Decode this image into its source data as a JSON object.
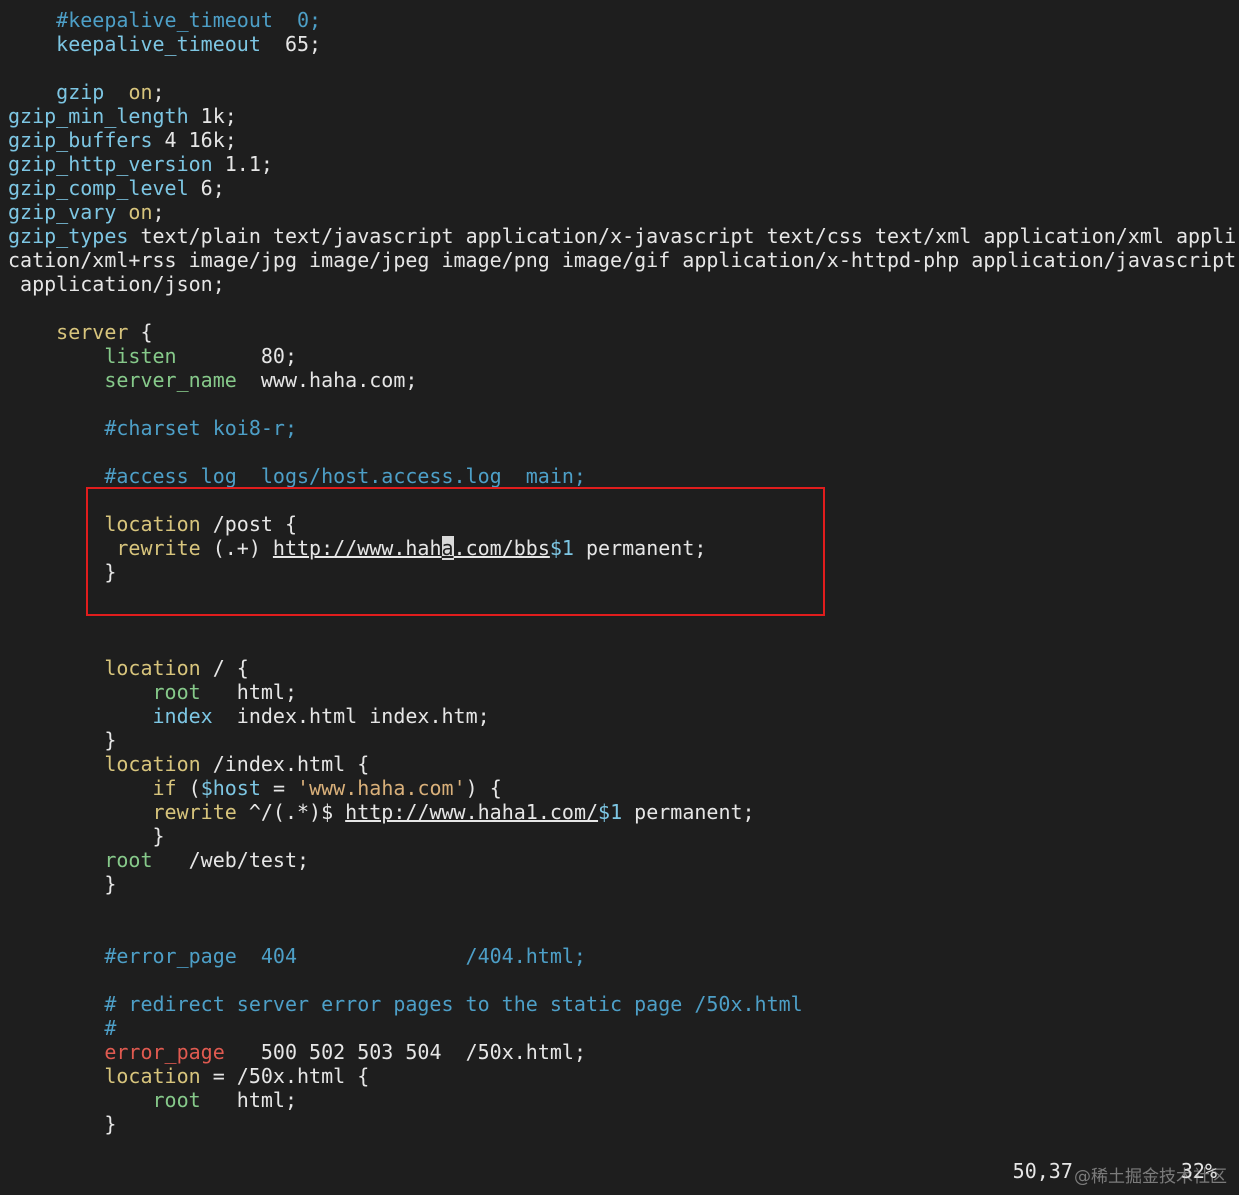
{
  "lines": [
    [
      {
        "t": "    "
      },
      {
        "t": "#keepalive_timeout  0;",
        "c": "cm"
      }
    ],
    [
      {
        "t": "    "
      },
      {
        "t": "keepalive_timeout",
        "c": "kw"
      },
      {
        "t": "  65;"
      }
    ],
    [
      {
        "t": ""
      }
    ],
    [
      {
        "t": "    "
      },
      {
        "t": "gzip",
        "c": "kw"
      },
      {
        "t": "  "
      },
      {
        "t": "on",
        "c": "kw2"
      },
      {
        "t": ";"
      }
    ],
    [
      {
        "t": "gzip_min_length",
        "c": "kw"
      },
      {
        "t": " 1k;"
      }
    ],
    [
      {
        "t": "gzip_buffers",
        "c": "kw"
      },
      {
        "t": " 4 16k;"
      }
    ],
    [
      {
        "t": "gzip_http_version",
        "c": "kw"
      },
      {
        "t": " 1.1;"
      }
    ],
    [
      {
        "t": "gzip_comp_level",
        "c": "kw"
      },
      {
        "t": " 6;"
      }
    ],
    [
      {
        "t": "gzip_vary",
        "c": "kw"
      },
      {
        "t": " "
      },
      {
        "t": "on",
        "c": "kw2"
      },
      {
        "t": ";"
      }
    ],
    [
      {
        "t": "gzip_types",
        "c": "kw"
      },
      {
        "t": " text/plain text/javascript application/x-javascript text/css text/xml application/xml appli"
      }
    ],
    [
      {
        "t": "cation/xml+rss image/jpg image/jpeg image/png image/gif application/x-httpd-php application/javascript"
      }
    ],
    [
      {
        "t": " application/json;"
      }
    ],
    [
      {
        "t": ""
      }
    ],
    [
      {
        "t": "    "
      },
      {
        "t": "server",
        "c": "kw2"
      },
      {
        "t": " {"
      }
    ],
    [
      {
        "t": "        "
      },
      {
        "t": "listen",
        "c": "kw3"
      },
      {
        "t": "       80;"
      }
    ],
    [
      {
        "t": "        "
      },
      {
        "t": "server_name",
        "c": "kw3"
      },
      {
        "t": "  www.haha.com;"
      }
    ],
    [
      {
        "t": ""
      }
    ],
    [
      {
        "t": "        "
      },
      {
        "t": "#charset koi8-r;",
        "c": "cm"
      }
    ],
    [
      {
        "t": ""
      }
    ],
    [
      {
        "t": "        "
      },
      {
        "t": "#access_log  logs/host.access.log  main;",
        "c": "cm"
      }
    ],
    [
      {
        "t": ""
      }
    ],
    [
      {
        "t": "        "
      },
      {
        "t": "location",
        "c": "kw2"
      },
      {
        "t": " /post {"
      }
    ],
    [
      {
        "t": "         "
      },
      {
        "t": "rewrite",
        "c": "kw2"
      },
      {
        "t": " (.+) "
      },
      {
        "t": "http://www.hah",
        "c": "url"
      },
      {
        "t": "a",
        "c": "cursor url"
      },
      {
        "t": ".com/bbs",
        "c": "url"
      },
      {
        "t": "$1",
        "c": "var"
      },
      {
        "t": " permanent;"
      }
    ],
    [
      {
        "t": "        }"
      }
    ],
    [
      {
        "t": ""
      }
    ],
    [
      {
        "t": ""
      }
    ],
    [
      {
        "t": ""
      }
    ],
    [
      {
        "t": "        "
      },
      {
        "t": "location",
        "c": "kw2"
      },
      {
        "t": " / {"
      }
    ],
    [
      {
        "t": "            "
      },
      {
        "t": "root",
        "c": "kw3"
      },
      {
        "t": "   html;"
      }
    ],
    [
      {
        "t": "            "
      },
      {
        "t": "index",
        "c": "kw"
      },
      {
        "t": "  index.html index.htm;"
      }
    ],
    [
      {
        "t": "        }"
      }
    ],
    [
      {
        "t": "        "
      },
      {
        "t": "location",
        "c": "kw2"
      },
      {
        "t": " /index.html {"
      }
    ],
    [
      {
        "t": "            "
      },
      {
        "t": "if",
        "c": "kw2"
      },
      {
        "t": " ("
      },
      {
        "t": "$host",
        "c": "var"
      },
      {
        "t": " = "
      },
      {
        "t": "'www.haha.com'",
        "c": "str"
      },
      {
        "t": ") {"
      }
    ],
    [
      {
        "t": "            "
      },
      {
        "t": "rewrite",
        "c": "kw2"
      },
      {
        "t": " ^/(.*)$ "
      },
      {
        "t": "http://www.haha1.com/",
        "c": "url"
      },
      {
        "t": "$1",
        "c": "var"
      },
      {
        "t": " permanent;"
      }
    ],
    [
      {
        "t": "            }"
      }
    ],
    [
      {
        "t": "        "
      },
      {
        "t": "root",
        "c": "kw3"
      },
      {
        "t": "   /web/test;"
      }
    ],
    [
      {
        "t": "        }"
      }
    ],
    [
      {
        "t": ""
      }
    ],
    [
      {
        "t": ""
      }
    ],
    [
      {
        "t": "        "
      },
      {
        "t": "#error_page  404              /404.html;",
        "c": "cm"
      }
    ],
    [
      {
        "t": ""
      }
    ],
    [
      {
        "t": "        "
      },
      {
        "t": "# redirect server error pages to the static page /50x.html",
        "c": "cm"
      }
    ],
    [
      {
        "t": "        "
      },
      {
        "t": "#",
        "c": "cm"
      }
    ],
    [
      {
        "t": "        "
      },
      {
        "t": "error_page",
        "c": "red"
      },
      {
        "t": "   500 502 503 504  /50x.html;"
      }
    ],
    [
      {
        "t": "        "
      },
      {
        "t": "location",
        "c": "kw2"
      },
      {
        "t": " = /50x.html {"
      }
    ],
    [
      {
        "t": "            "
      },
      {
        "t": "root",
        "c": "kw3"
      },
      {
        "t": "   html;"
      }
    ],
    [
      {
        "t": "        }"
      }
    ]
  ],
  "status": {
    "position": "50,37",
    "percent": "32%"
  },
  "watermark": "@稀土掘金技术社区"
}
